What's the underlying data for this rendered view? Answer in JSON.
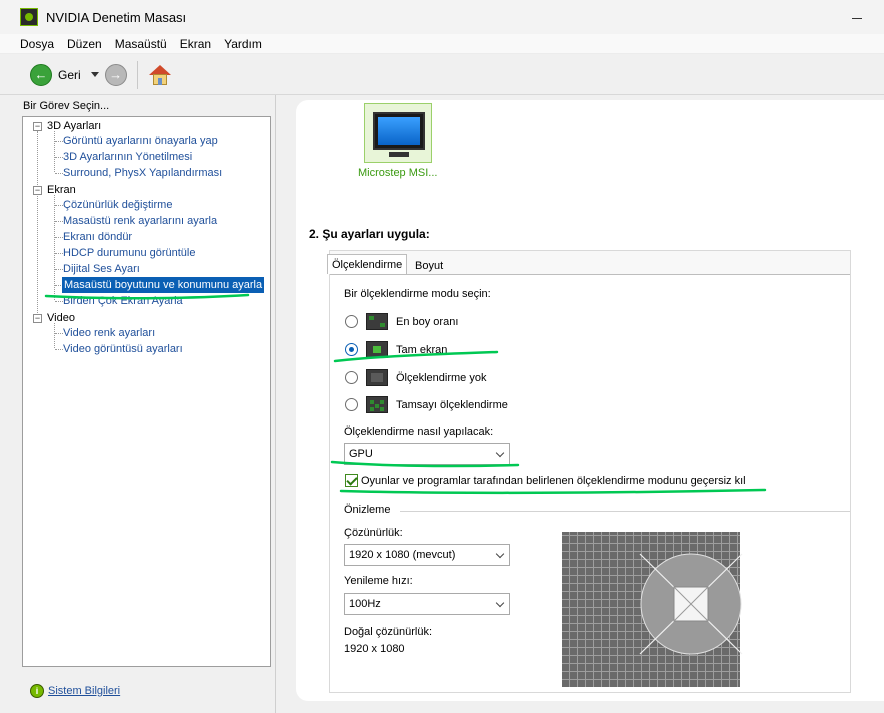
{
  "window": {
    "title": "NVIDIA Denetim Masası"
  },
  "menu": [
    "Dosya",
    "Düzen",
    "Masaüstü",
    "Ekran",
    "Yardım"
  ],
  "toolbar": {
    "back_label": "Geri"
  },
  "left": {
    "task_label": "Bir Görev Seçin...",
    "categories": [
      {
        "label": "3D Ayarları",
        "items": [
          "Görüntü ayarlarını önayarla yap",
          "3D Ayarlarının Yönetilmesi",
          "Surround, PhysX Yapılandırması"
        ]
      },
      {
        "label": "Ekran",
        "items": [
          "Çözünürlük değiştirme",
          "Masaüstü renk ayarlarını ayarla",
          "Ekranı döndür",
          "HDCP durumunu görüntüle",
          "Dijital Ses Ayarı",
          "Masaüstü boyutunu ve konumunu ayarla",
          "Birden Çok Ekran Ayarla"
        ]
      },
      {
        "label": "Video",
        "items": [
          "Video renk ayarları",
          "Video görüntüsü ayarları"
        ]
      }
    ],
    "system_info": "Sistem Bilgileri"
  },
  "right": {
    "monitor_label": "Microstep MSI...",
    "section_title": "2. Şu ayarları uygula:",
    "tabs": [
      "Ölçeklendirme",
      "Boyut"
    ],
    "mode_prompt": "Bir ölçeklendirme modu seçin:",
    "modes": [
      "En boy oranı",
      "Tam ekran",
      "Ölçeklendirme yok",
      "Tamsayı ölçeklendirme"
    ],
    "selected_mode": "Tam ekran",
    "perform_label": "Ölçeklendirme nasıl yapılacak:",
    "perform_value": "GPU",
    "override_label": "Oyunlar ve programlar tarafından belirlenen ölçeklendirme modunu geçersiz kıl",
    "override_checked": true,
    "preview_title": "Önizleme",
    "resolution_label": "Çözünürlük:",
    "resolution_value": "1920 x 1080 (mevcut)",
    "refresh_label": "Yenileme hızı:",
    "refresh_value": "100Hz",
    "native_label": "Doğal çözünürlük:",
    "native_value": "1920 x 1080"
  },
  "colors": {
    "nvidia_green": "#76b900",
    "selection": "#0a5fb4",
    "annotation": "#00c853"
  }
}
